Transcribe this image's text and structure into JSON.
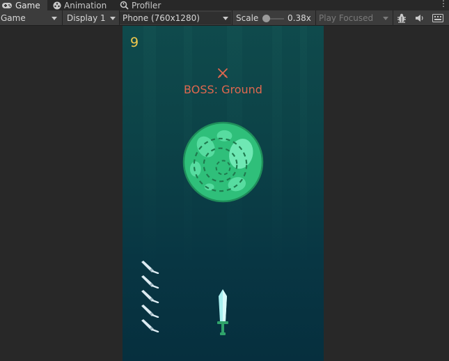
{
  "tabs": [
    {
      "label": "Game",
      "icon": "gamepad-icon",
      "active": true
    },
    {
      "label": "Animation",
      "icon": "animation-icon",
      "active": false
    },
    {
      "label": "Profiler",
      "icon": "profiler-icon",
      "active": false
    }
  ],
  "tab_menu_glyph": "⋮",
  "toolbar": {
    "view_mode": "Game",
    "display": "Display 1",
    "aspect": "Phone (760x1280)",
    "scale_label": "Scale",
    "scale_value": "0.38x",
    "scale_fraction": 0.0,
    "play_mode": "Play Focused"
  },
  "game": {
    "score": "9",
    "boss_label": "BOSS: Ground",
    "knives_remaining": 5,
    "colors": {
      "score": "#f2c94c",
      "boss_label": "#e0684f",
      "planet": "#2fbf7a",
      "knife": "#cfe8f2"
    }
  }
}
